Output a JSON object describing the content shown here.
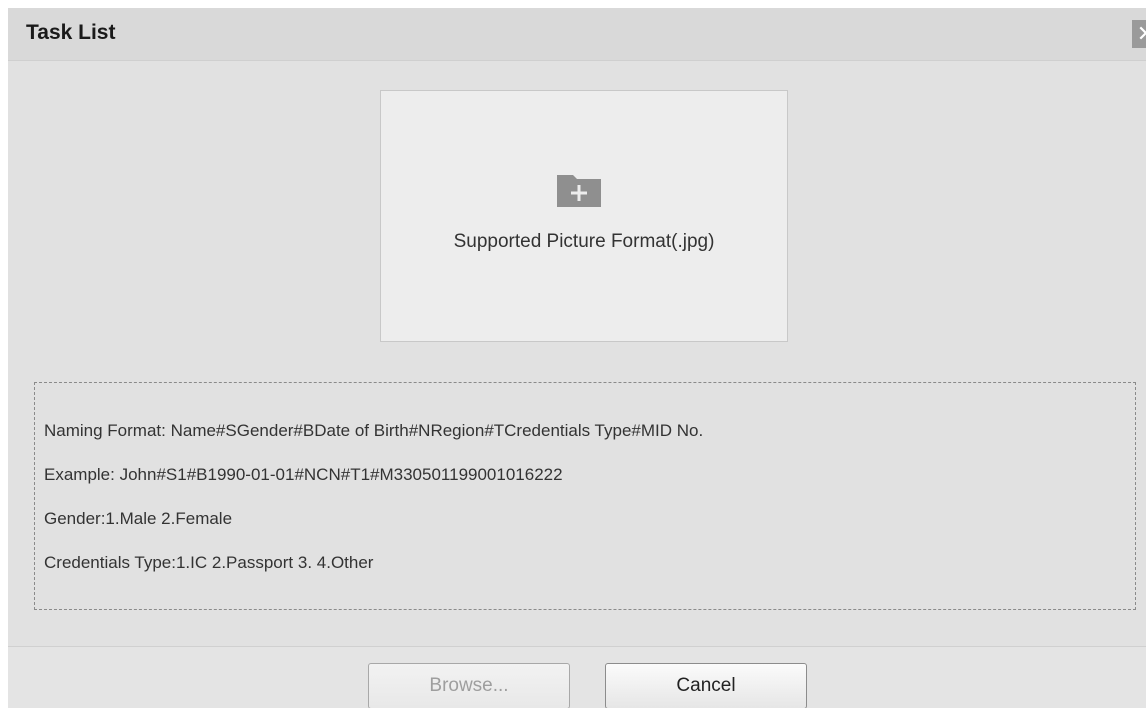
{
  "dialog": {
    "title": "Task List",
    "close_label": "✕"
  },
  "upload": {
    "icon": "folder-add-icon",
    "text": "Supported Picture Format(.jpg)"
  },
  "info": {
    "lines": [
      "Naming Format: Name#SGender#BDate of Birth#NRegion#TCredentials Type#MID No.",
      "Example:  John#S1#B1990-01-01#NCN#T1#M330501199001016222",
      "Gender:1.Male 2.Female",
      "Credentials Type:1.IC 2.Passport 3. 4.Other"
    ]
  },
  "footer": {
    "browse_label": "Browse...",
    "browse_disabled": true,
    "cancel_label": "Cancel"
  },
  "colors": {
    "background": "#e1e1e1",
    "upload_box": "#ededed",
    "icon": "#8f8f8f"
  }
}
